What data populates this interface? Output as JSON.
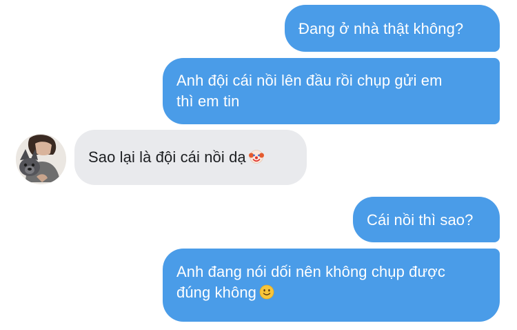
{
  "messages": [
    {
      "sender": "me",
      "lines": [
        "Đang ở nhà thật không?"
      ]
    },
    {
      "sender": "me",
      "lines": [
        "Anh đội cái nồi lên đầu rồi chụp gửi em",
        "thì em tin"
      ]
    },
    {
      "sender": "other",
      "lines": [
        "Sao lại là đội cái nồi dạ"
      ],
      "emoji": "clown-face-icon"
    },
    {
      "sender": "me",
      "lines": [
        "Cái nồi thì sao?"
      ]
    },
    {
      "sender": "me",
      "lines": [
        "Anh đang nói dối nên không chụp được",
        "đúng không"
      ],
      "emoji": "slightly-smiling-face-icon"
    }
  ],
  "avatar": {
    "icon": "person-with-dog-avatar"
  },
  "colors": {
    "outgoing_bubble": "#4a9ce8",
    "incoming_bubble": "#e9eaed",
    "outgoing_text": "#ffffff",
    "incoming_text": "#1c1e21"
  }
}
